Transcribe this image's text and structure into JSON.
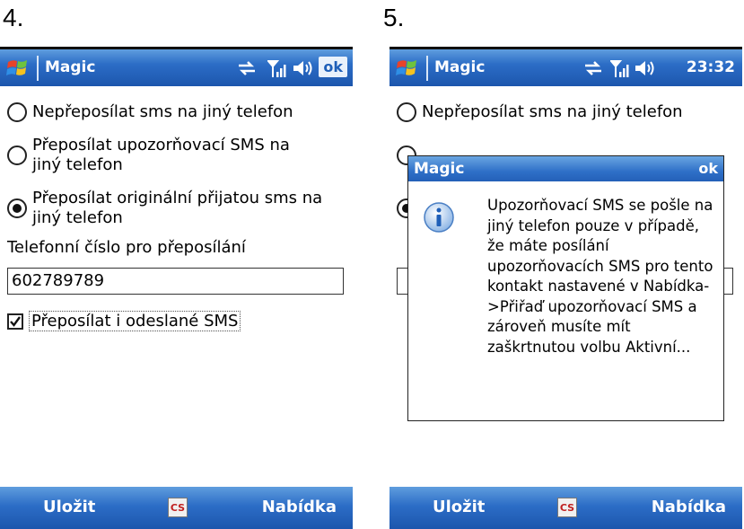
{
  "steps": {
    "left": "4.",
    "right": "5."
  },
  "colors": {
    "titlebar": "#2c6dc6",
    "softkey_bar": "#2c6dc6",
    "accent": "#1f5fb8"
  },
  "icons": {
    "start": "windows-flag-icon",
    "connectivity": "sync-arrows-icon",
    "signal": "signal-bars-icon",
    "volume": "speaker-icon",
    "input": "cs-input-icon",
    "info": "info-icon"
  },
  "screen4": {
    "title": "Magic",
    "ok": "ok",
    "options": [
      {
        "label": "Nepřeposílat sms na jiný telefon",
        "selected": false
      },
      {
        "label": "Přeposílat upozorňovací SMS na jiný telefon",
        "selected": false
      },
      {
        "label": "Přeposílat originální přijatou sms na jiný telefon",
        "selected": true
      }
    ],
    "phone_label": "Telefonní číslo pro přeposílání",
    "phone_value": "602789789",
    "checkbox": {
      "label": "Přeposílat i odeslané SMS",
      "checked": true
    },
    "soft_left": "Uložit",
    "input_indicator": "CS",
    "soft_right": "Nabídka"
  },
  "screen5": {
    "title": "Magic",
    "clock": "23:32",
    "background_option": "Nepřeposílat sms na jiný telefon",
    "dialog": {
      "title": "Magic",
      "ok": "ok",
      "message": "Upozorňovací SMS se pošle na jiný telefon pouze v případě, že máte posílání upozorňovacích SMS pro tento kontakt nastavené v Nabídka->Přiřaď upozorňovací SMS a zároveň musíte mít zaškrtnutou volbu Aktivní..."
    },
    "soft_left": "Uložit",
    "input_indicator": "CS",
    "soft_right": "Nabídka"
  }
}
